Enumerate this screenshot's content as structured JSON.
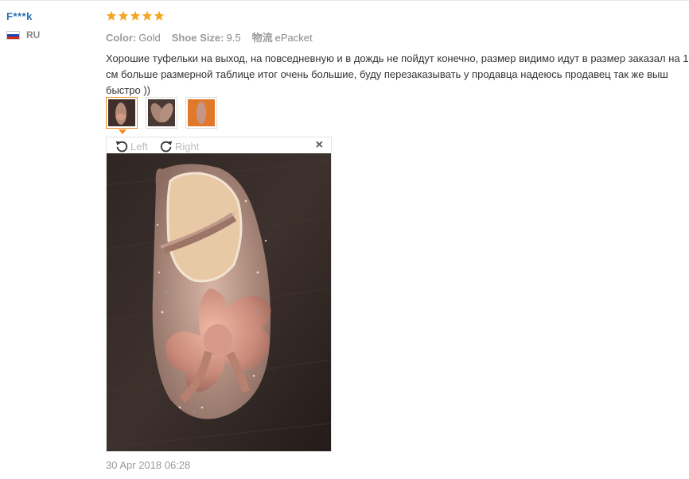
{
  "user": {
    "name": "F***k",
    "country": "RU"
  },
  "review": {
    "rating": 5,
    "rating_max": 5,
    "color_label": "Color:",
    "color_value": "Gold",
    "size_label": "Shoe Size:",
    "size_value": "9.5",
    "shipping_label": "物流",
    "shipping_value": "ePacket",
    "text": "Хорошие туфельки на выход, на повседневную и в дождь не пойдут конечно, размер видимо идут в размер заказал на 1 см больше размерной таблице итог очень большие, буду перезаказывать у продавца надеюсь продавец так же выш\nбыстро ))",
    "date": "30 Apr 2018 06:28"
  },
  "viewer": {
    "rotate_left_label": "Left",
    "rotate_right_label": "Right",
    "close_label": "×"
  },
  "colors": {
    "star": "#f5a623",
    "link": "#2b6fb6",
    "accent": "#f08c26"
  }
}
